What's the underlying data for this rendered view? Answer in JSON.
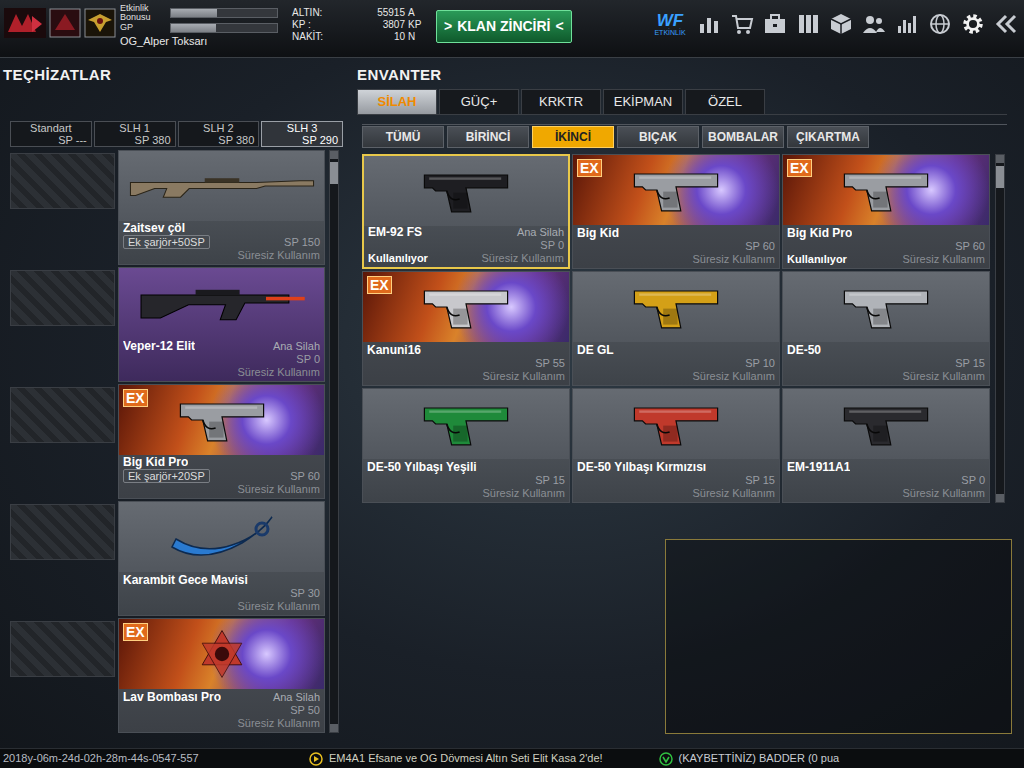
{
  "player": {
    "bonus_label": "Etkinlik Bonusu",
    "bonus_level": 0.43,
    "gp_label": "GP",
    "gp_level": 0.42,
    "name": "OG_Alper Toksarı"
  },
  "currency": [
    {
      "label": "ALTIN:",
      "value": "55915",
      "unit": "A"
    },
    {
      "label": "KP :",
      "value": "3807",
      "unit": "KP"
    },
    {
      "label": "NAKİT:",
      "value": "10",
      "unit": "N"
    }
  ],
  "clan_button": {
    "left": ">",
    "label": "KLAN ZİNCİRİ",
    "right": "<"
  },
  "event_logo": {
    "text": "WF",
    "caption": "ETKİNLİK"
  },
  "toolbar": [
    {
      "kind": "stats"
    },
    {
      "kind": "cart"
    },
    {
      "kind": "bag"
    },
    {
      "kind": "tiles"
    },
    {
      "kind": "box"
    },
    {
      "kind": "people"
    },
    {
      "kind": "chart"
    },
    {
      "kind": "globe"
    },
    {
      "kind": "gear"
    },
    {
      "kind": "back"
    }
  ],
  "equipment": {
    "title": "TEÇHİZATLAR",
    "slots": [
      {
        "name": "Standart",
        "sp": "SP ---",
        "selected": false
      },
      {
        "name": "SLH 1",
        "sp": "SP 380",
        "selected": false
      },
      {
        "name": "SLH 2",
        "sp": "SP 380",
        "selected": false
      },
      {
        "name": "SLH 3",
        "sp": "SP 290",
        "selected": true
      }
    ],
    "items": [
      {
        "name": "Zaitsev çöl",
        "tag": "Ek şarjör+50SP",
        "role": "",
        "sp": "SP 150",
        "duration": "Süresiz Kullanım",
        "kind": "rifle",
        "color": "#8a7a62",
        "tier": "normal",
        "badge": ""
      },
      {
        "name": "Veper-12 Elit",
        "tag": "",
        "role": "Ana Silah",
        "sp": "SP 0",
        "duration": "Süresiz Kullanım",
        "kind": "shotgun",
        "color": "#26262b",
        "tier": "elite",
        "badge": ""
      },
      {
        "name": "Big Kid Pro",
        "tag": "Ek şarjör+20SP",
        "role": "",
        "sp": "SP 60",
        "duration": "Süresiz Kullanım",
        "kind": "pistol",
        "color": "#9a9da2",
        "tier": "ex",
        "badge": "EX"
      },
      {
        "name": "Karambit Gece Mavisi",
        "tag": "",
        "role": "",
        "sp": "SP 30",
        "duration": "Süresiz Kullanım",
        "kind": "knife",
        "color": "#2a7ad0",
        "tier": "normal",
        "badge": ""
      },
      {
        "name": "Lav Bombası Pro",
        "tag": "",
        "role": "Ana Silah",
        "sp": "SP 50",
        "duration": "Süresiz Kullanım",
        "kind": "grenade",
        "color": "#c0392b",
        "tier": "ex",
        "badge": "EX"
      }
    ]
  },
  "inventory": {
    "title": "ENVANTER",
    "tabs": [
      {
        "label": "SİLAH",
        "selected": true
      },
      {
        "label": "GÜÇ+",
        "selected": false
      },
      {
        "label": "KRKTR",
        "selected": false
      },
      {
        "label": "EKİPMAN",
        "selected": false
      },
      {
        "label": "ÖZEL",
        "selected": false
      }
    ],
    "subtabs": [
      {
        "label": "TÜMÜ",
        "selected": false
      },
      {
        "label": "BİRİNCİ",
        "selected": false
      },
      {
        "label": "İKİNCİ",
        "selected": true
      },
      {
        "label": "BIÇAK",
        "selected": false
      },
      {
        "label": "BOMBALAR",
        "selected": false
      },
      {
        "label": "ÇIKARTMA",
        "selected": false
      }
    ],
    "items": [
      {
        "name": "EM-92 FS",
        "role": "Ana Silah",
        "sp": "SP 0",
        "status": "Kullanılıyor",
        "duration": "Süresiz Kullanım",
        "kind": "pistol",
        "color": "#1e1e22",
        "tier": "normal",
        "badge": "",
        "selected": true
      },
      {
        "name": "Big Kid",
        "role": "",
        "sp": "SP 60",
        "status": "",
        "duration": "Süresiz Kullanım",
        "kind": "pistol",
        "color": "#9a9da2",
        "tier": "ex",
        "badge": "EX",
        "selected": false
      },
      {
        "name": "Big Kid Pro",
        "role": "",
        "sp": "SP 60",
        "status": "Kullanılıyor",
        "duration": "Süresiz Kullanım",
        "kind": "pistol",
        "color": "#9a9da2",
        "tier": "ex",
        "badge": "EX",
        "selected": false
      },
      {
        "name": "Kanuni16",
        "role": "",
        "sp": "SP 55",
        "status": "",
        "duration": "Süresiz Kullanım",
        "kind": "pistol",
        "color": "#c8c8cc",
        "tier": "ex",
        "badge": "EX",
        "selected": false
      },
      {
        "name": "DE GL",
        "role": "",
        "sp": "SP 10",
        "status": "",
        "duration": "Süresiz Kullanım",
        "kind": "pistol",
        "color": "#d4a017",
        "tier": "normal",
        "badge": "",
        "selected": false
      },
      {
        "name": "DE-50",
        "role": "",
        "sp": "SP 15",
        "status": "",
        "duration": "Süresiz Kullanım",
        "kind": "pistol",
        "color": "#b0b3b8",
        "tier": "normal",
        "badge": "",
        "selected": false
      },
      {
        "name": "DE-50 Yılbaşı Yeşili",
        "role": "",
        "sp": "SP 15",
        "status": "",
        "duration": "Süresiz Kullanım",
        "kind": "pistol",
        "color": "#1f8a3a",
        "tier": "normal",
        "badge": "",
        "selected": false
      },
      {
        "name": "DE-50 Yılbaşı Kırmızısı",
        "role": "",
        "sp": "SP 15",
        "status": "",
        "duration": "Süresiz Kullanım",
        "kind": "pistol",
        "color": "#c0392b",
        "tier": "normal",
        "badge": "",
        "selected": false
      },
      {
        "name": "EM-1911A1",
        "role": "",
        "sp": "SP 0",
        "status": "",
        "duration": "Süresiz Kullanım",
        "kind": "pistol",
        "color": "#2a2a2e",
        "tier": "normal",
        "badge": "",
        "selected": false
      }
    ]
  },
  "status_bar": {
    "timestamp": "2018y-06m-24d-02h-28m-44s-0547-557",
    "news": "EM4A1 Efsane ve OG Dövmesi Altın Seti Elit Kasa 2'de!",
    "kill": "(KAYBETTİNİZ) BADDER (0 pua"
  }
}
